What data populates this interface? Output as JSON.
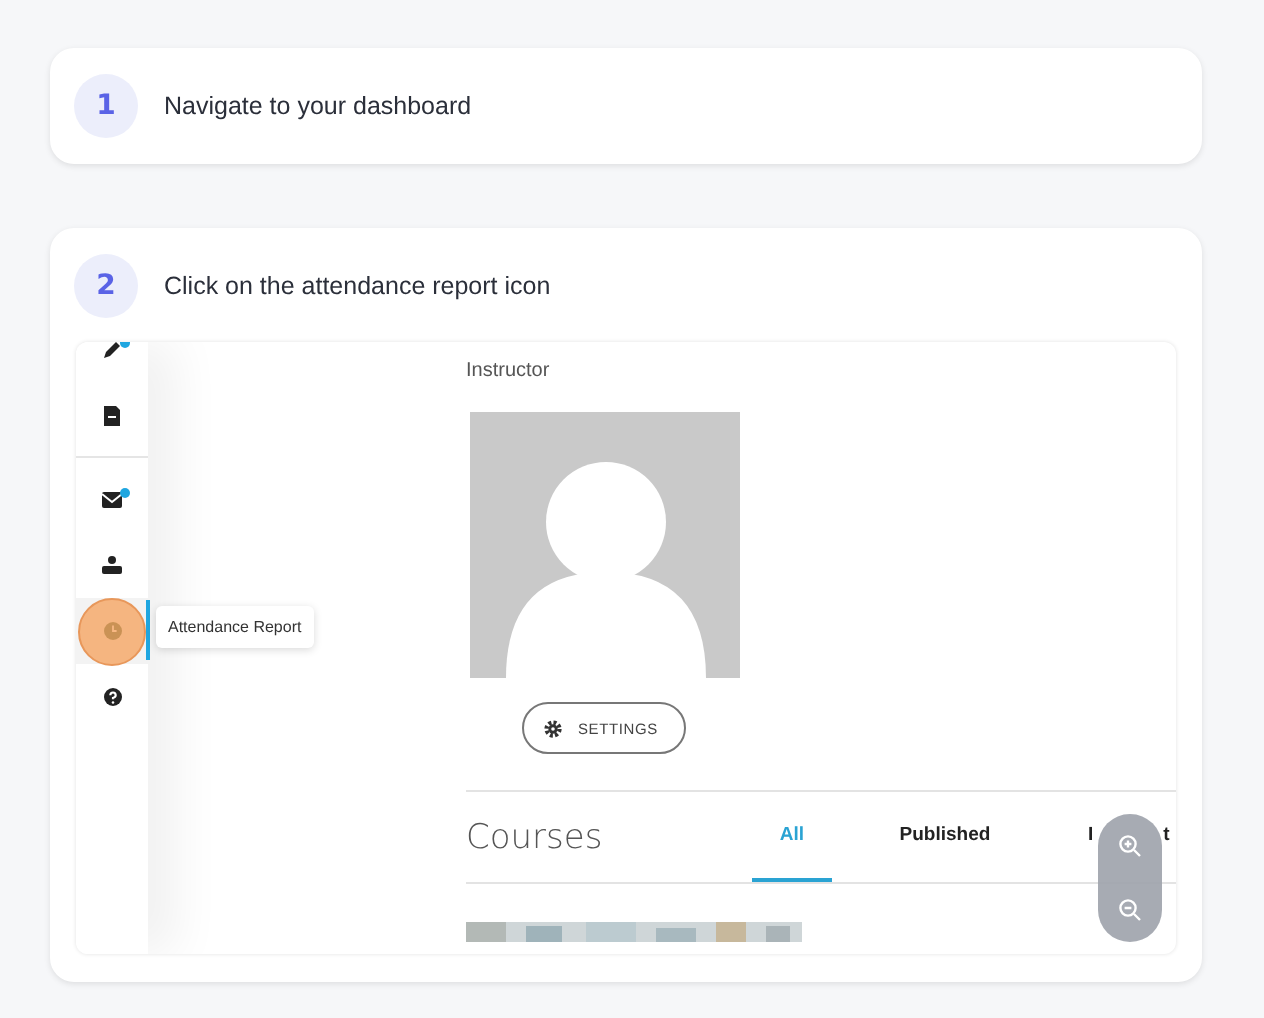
{
  "steps": [
    {
      "number": "1",
      "text": "Navigate to your dashboard"
    },
    {
      "number": "2",
      "text": "Click on the attendance report icon"
    }
  ],
  "screenshot": {
    "sidebar": [
      {
        "kind": "pen",
        "selected": false,
        "badge": true
      },
      {
        "kind": "document",
        "selected": false,
        "badge": false
      },
      {
        "kind": "divider"
      },
      {
        "kind": "mail",
        "selected": false,
        "badge": true
      },
      {
        "kind": "person",
        "selected": false,
        "badge": false
      },
      {
        "kind": "clock",
        "selected": true,
        "badge": false,
        "highlighted": true
      },
      {
        "kind": "help",
        "selected": false,
        "badge": false
      }
    ],
    "tooltip": "Attendance Report",
    "role": "Instructor",
    "settings_button": "SETTINGS",
    "courses_heading": "Courses",
    "tabs": [
      {
        "label": "All",
        "selected": true
      },
      {
        "label": "Published",
        "selected": false
      },
      {
        "label_parts": [
          "I",
          "t"
        ],
        "selected": false
      }
    ]
  }
}
